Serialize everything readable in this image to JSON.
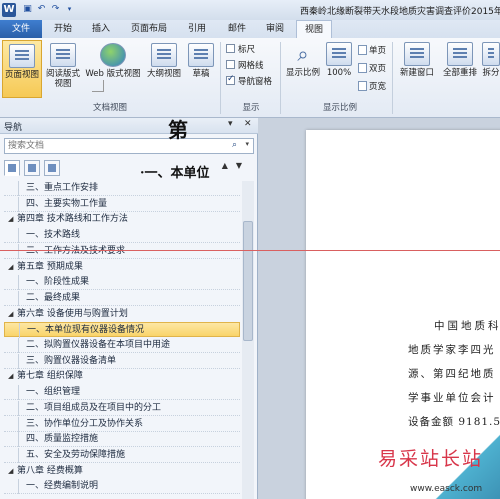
{
  "window": {
    "title": "西秦岭北缘断裂带天水段地质灾害调查评价2015年续作"
  },
  "tabs": [
    "开始",
    "插入",
    "页面布局",
    "引用",
    "邮件",
    "审阅",
    "视图"
  ],
  "file_tab": "文件",
  "active_tab": "视图",
  "ribbon": {
    "views": {
      "print_layout": "页面视图",
      "reading": "阅读版式\n视图",
      "web": "Web 版式视图",
      "outline": "大纲视图",
      "draft": "草稿",
      "group": "文档视图"
    },
    "show": {
      "ruler": "标尺",
      "gridlines": "网格线",
      "nav_pane": "导航窗格",
      "ruler_checked": false,
      "gridlines_checked": false,
      "nav_pane_checked": true,
      "group": "显示"
    },
    "zoom": {
      "zoom": "显示比例",
      "hundred": "100%",
      "one_page": "单页",
      "two_pages": "双页",
      "page_width": "页宽",
      "group": "显示比例"
    },
    "window": {
      "new_window": "新建窗口",
      "arrange_all": "全部重排",
      "split": "拆分"
    }
  },
  "nav": {
    "title": "导航",
    "search_placeholder": "搜索文档",
    "items": [
      {
        "level": 2,
        "text": "三、重点工作安排"
      },
      {
        "level": 2,
        "text": "四、主要实物工作量"
      },
      {
        "level": 1,
        "text": "第四章 技术路线和工作方法"
      },
      {
        "level": 2,
        "text": "一、技术路线"
      },
      {
        "level": 2,
        "text": "二、工作方法及技术要求"
      },
      {
        "level": 1,
        "text": "第五章 预期成果"
      },
      {
        "level": 2,
        "text": "一、阶段性成果"
      },
      {
        "level": 2,
        "text": "二、最终成果"
      },
      {
        "level": 1,
        "text": "第六章 设备使用与购置计划"
      },
      {
        "level": 2,
        "text": "一、本单位现有仪器设备情况",
        "selected": true
      },
      {
        "level": 2,
        "text": "二、拟购置仪器设备在本项目中用途"
      },
      {
        "level": 2,
        "text": "三、购置仪器设备清单"
      },
      {
        "level": 1,
        "text": "第七章 组织保障"
      },
      {
        "level": 2,
        "text": "一、组织管理"
      },
      {
        "level": 2,
        "text": "二、项目组成员及在项目中的分工"
      },
      {
        "level": 2,
        "text": "三、协作单位分工及协作关系"
      },
      {
        "level": 2,
        "text": "四、质量监控措施"
      },
      {
        "level": 2,
        "text": "五、安全及劳动保障措施"
      },
      {
        "level": 1,
        "text": "第八章 经费概算"
      },
      {
        "level": 2,
        "text": "一、经费编制说明"
      }
    ]
  },
  "document": {
    "heading": "第",
    "subheading": "·一、本单位",
    "lines": [
      "中国地质科",
      "地质学家李四光",
      "源、第四纪地质",
      "学事业单位会计",
      "设备金额 9181.5"
    ]
  },
  "watermark": {
    "text": "易采站长站",
    "url": "www.easck.com"
  }
}
